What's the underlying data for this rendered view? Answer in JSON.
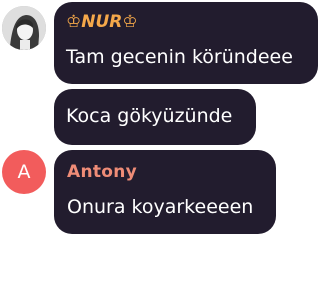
{
  "messages": [
    {
      "sender_name": "♔NUR♔",
      "text": "Tam gecenin köründeee",
      "avatar": "profile-photo"
    },
    {
      "text": "Koca gökyüzünde"
    },
    {
      "sender_name": "Antony",
      "text": "Onura koyarkeeeen",
      "avatar_letter": "A"
    }
  ],
  "colors": {
    "bubble_bg": "#221c2e",
    "nur_name": "#f5a84a",
    "antony_name": "#ef8c77",
    "avatar_a_bg": "#f25c5c",
    "message_text": "#ffffff"
  }
}
